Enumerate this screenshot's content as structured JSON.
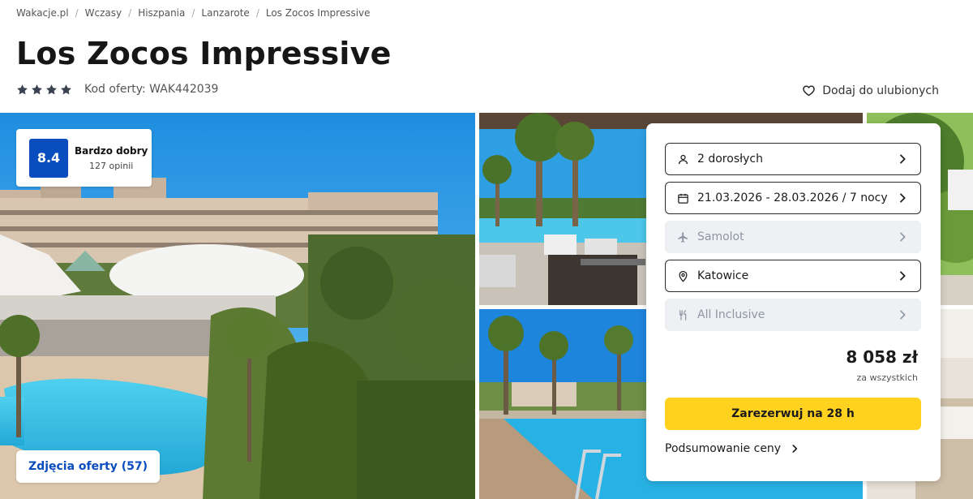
{
  "breadcrumb": [
    "Wakacje.pl",
    "Wczasy",
    "Hiszpania",
    "Lanzarote",
    "Los Zocos Impressive"
  ],
  "breadcrumb_separator": "/",
  "hotel": {
    "name": "Los Zocos Impressive",
    "stars": 4,
    "offer_code": "Kod oferty: WAK442039",
    "favorite_label": "Dodaj do ulubionych"
  },
  "rating": {
    "score": "8.4",
    "label": "Bardzo dobry",
    "reviews": "127 opinii"
  },
  "gallery": {
    "photos_button": "Zdjęcia oferty (57)"
  },
  "booking": {
    "travelers": {
      "icon": "person-icon",
      "value": "2 dorosłych"
    },
    "dates": {
      "icon": "calendar-icon",
      "value": "21.03.2026 - 28.03.2026 / 7 nocy"
    },
    "transport": {
      "icon": "plane-icon",
      "value": "Samolot"
    },
    "departure": {
      "icon": "location-pin-icon",
      "value": "Katowice"
    },
    "board": {
      "icon": "cutlery-icon",
      "value": "All Inclusive"
    },
    "price": "8 058 zł",
    "price_note": "za wszystkich",
    "reserve_label": "Zarezerwuj na 28 h",
    "summary_label": "Podsumowanie ceny"
  },
  "colors": {
    "accent_blue": "#0a4dbf",
    "reserve_yellow": "#ffd21f",
    "star_color": "#3a4150"
  }
}
